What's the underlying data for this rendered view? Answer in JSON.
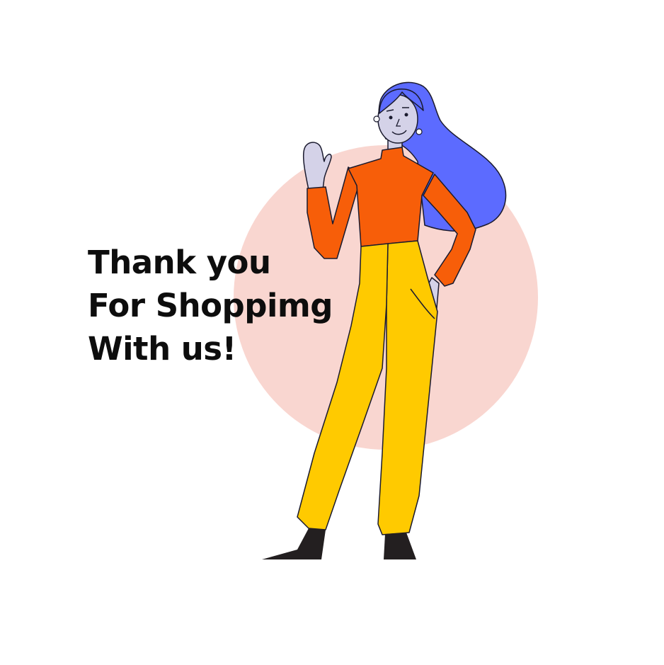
{
  "message": {
    "line1": "Thank you",
    "line2": "For Shoppimg",
    "line3": "With us!"
  },
  "illustration": {
    "subject": "waving-woman",
    "colors": {
      "background": "#ffffff",
      "circle": "#f9d6d0",
      "hair": "#5c6bff",
      "skin": "#d4d2e8",
      "shirt": "#f75e09",
      "pants": "#ffca00",
      "shoes": "#231f20",
      "outline": "#1a1a2e"
    }
  }
}
